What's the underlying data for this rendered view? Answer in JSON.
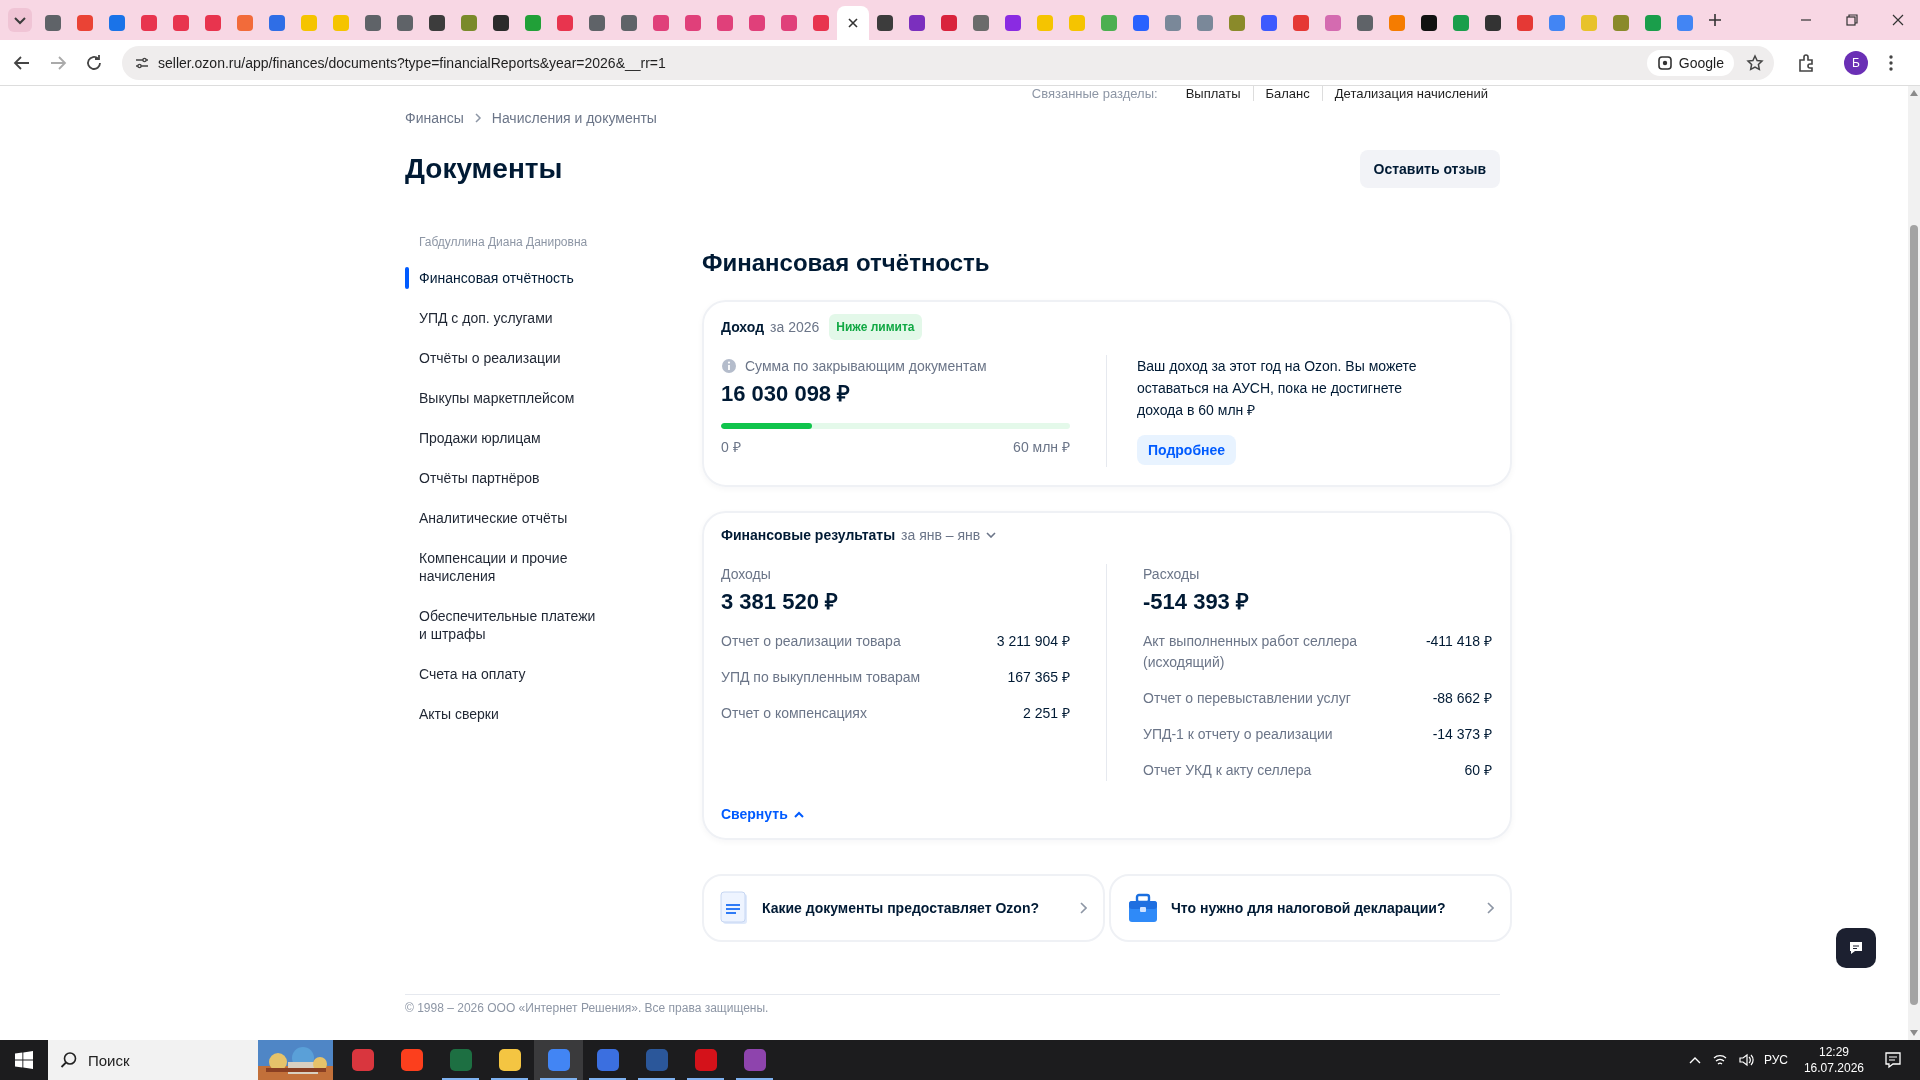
{
  "browser": {
    "tabs": [
      {
        "color": "#5f6368",
        "selected": false
      },
      {
        "color": "#ea4335",
        "selected": false
      },
      {
        "color": "#1a73e8",
        "selected": false
      },
      {
        "color": "#e8344e",
        "selected": false
      },
      {
        "color": "#e8344e",
        "selected": false
      },
      {
        "color": "#e8344e",
        "selected": false
      },
      {
        "color": "#f26b3a",
        "selected": false
      },
      {
        "color": "#2f6ee6",
        "selected": false
      },
      {
        "color": "#f5c400",
        "selected": false
      },
      {
        "color": "#f5c400",
        "selected": false
      },
      {
        "color": "#5f6368",
        "selected": false
      },
      {
        "color": "#5f6368",
        "selected": false
      },
      {
        "color": "#3c3c3c",
        "selected": false
      },
      {
        "color": "#7a8a2a",
        "selected": false
      },
      {
        "color": "#2b2b2b",
        "selected": false
      },
      {
        "color": "#21a038",
        "selected": false
      },
      {
        "color": "#e8344e",
        "selected": false
      },
      {
        "color": "#5f6368",
        "selected": false
      },
      {
        "color": "#5f6368",
        "selected": false
      },
      {
        "color": "#e0407a",
        "selected": false
      },
      {
        "color": "#e0407a",
        "selected": false
      },
      {
        "color": "#e0407a",
        "selected": false
      },
      {
        "color": "#e0407a",
        "selected": false
      },
      {
        "color": "#e0407a",
        "selected": false
      },
      {
        "color": "#e8344e",
        "selected": false
      },
      {
        "selected": true
      },
      {
        "color": "#3c3c3c",
        "selected": false
      },
      {
        "color": "#7b2fbe",
        "selected": false
      },
      {
        "color": "#d9233c",
        "selected": false
      },
      {
        "color": "#6b6b6b",
        "selected": false
      },
      {
        "color": "#8a2be2",
        "selected": false
      },
      {
        "color": "#f5c400",
        "selected": false
      },
      {
        "color": "#f5c400",
        "selected": false
      },
      {
        "color": "#4caf50",
        "selected": false
      },
      {
        "color": "#2962ff",
        "selected": false
      },
      {
        "color": "#7a8899",
        "selected": false
      },
      {
        "color": "#7a8899",
        "selected": false
      },
      {
        "color": "#8a8a2a",
        "selected": false
      },
      {
        "color": "#3d5afe",
        "selected": false
      },
      {
        "color": "#e53935",
        "selected": false
      },
      {
        "color": "#d46bb0",
        "selected": false
      },
      {
        "color": "#5f6368",
        "selected": false
      },
      {
        "color": "#f57c00",
        "selected": false
      },
      {
        "color": "#111111",
        "selected": false
      },
      {
        "color": "#1a9e4b",
        "selected": false
      },
      {
        "color": "#333333",
        "selected": false
      },
      {
        "color": "#e53935",
        "selected": false
      },
      {
        "color": "#4285f4",
        "selected": false
      },
      {
        "color": "#e8c22a",
        "selected": false
      },
      {
        "color": "#8a8a2a",
        "selected": false
      },
      {
        "color": "#1a9e4b",
        "selected": false
      },
      {
        "color": "#4285f4",
        "selected": false
      }
    ],
    "url": "seller.ozon.ru/app/finances/documents?type=financialReports&year=2026&__rr=1",
    "search_chip": "Google",
    "profile": "Б"
  },
  "related": {
    "label": "Связанные разделы:",
    "links": [
      "Выплаты",
      "Баланс",
      "Детализация начислений"
    ]
  },
  "breadcrumbs": [
    "Финансы",
    "Начисления и документы"
  ],
  "page_title": "Документы",
  "feedback_button": "Оставить отзыв",
  "sidebar": {
    "owner": "Габдуллина Диана Данировна",
    "items": [
      {
        "label": "Финансовая отчётность",
        "selected": true
      },
      {
        "label": "УПД с доп. услугами",
        "selected": false
      },
      {
        "label": "Отчёты о реализации",
        "selected": false
      },
      {
        "label": "Выкупы маркетплейсом",
        "selected": false
      },
      {
        "label": "Продажи юрлицам",
        "selected": false
      },
      {
        "label": "Отчёты партнёров",
        "selected": false
      },
      {
        "label": "Аналитические отчёты",
        "selected": false
      },
      {
        "label": "Компенсации и прочие начисления",
        "selected": false
      },
      {
        "label": "Обеспечительные платежи и штрафы",
        "selected": false
      },
      {
        "label": "Счета на оплату",
        "selected": false
      },
      {
        "label": "Акты сверки",
        "selected": false
      }
    ]
  },
  "section_title": "Финансовая отчётность",
  "income_card": {
    "title": "Доход",
    "period": "за 2026",
    "badge": "Ниже лимита",
    "caption": "Сумма по закрывающим документам",
    "amount": "16 030 098 ₽",
    "level": 0.26,
    "min_label": "0 ₽",
    "max_label": "60 млн ₽",
    "note": "Ваш доход за этот год на Ozon. Вы можете оставаться на АУСН, пока не достигнете дохода в 60 млн ₽",
    "button": "Подробнее"
  },
  "results_card": {
    "title": "Финансовые результаты",
    "period": "за янв – янв",
    "columns": [
      {
        "label": "Доходы",
        "total": "3 381 520 ₽",
        "rows": [
          {
            "name": "Отчет о реализации товара",
            "amount": "3 211 904 ₽"
          },
          {
            "name": "УПД по выкупленным товарам",
            "amount": "167 365 ₽"
          },
          {
            "name": "Отчет о компенсациях",
            "amount": "2 251 ₽"
          }
        ]
      },
      {
        "label": "Расходы",
        "total": "-514 393 ₽",
        "rows": [
          {
            "name": "Акт выполненных работ селлера (исходящий)",
            "amount": "-411 418 ₽"
          },
          {
            "name": "Отчет о перевыставлении услуг",
            "amount": "-88 662 ₽"
          },
          {
            "name": "УПД-1 к отчету о реализации",
            "amount": "-14 373 ₽"
          },
          {
            "name": "Отчет УКД к акту селлера",
            "amount": "60 ₽"
          }
        ]
      }
    ],
    "collapse": "Свернуть"
  },
  "help_links": [
    {
      "kind": "document",
      "text": "Какие документы предоставляет Ozon?"
    },
    {
      "kind": "briefcase",
      "text": "Что нужно для налоговой декларации?"
    }
  ],
  "footer": "© 1998 – 2026 ООО «Интернет Решения». Все права защищены.",
  "taskbar": {
    "search_placeholder": "Поиск",
    "apps": [
      {
        "color": "#d9363e",
        "selected": false,
        "running": false
      },
      {
        "color": "#fc3f1d",
        "selected": false,
        "running": false
      },
      {
        "color": "#1d6f42",
        "selected": false,
        "running": true
      },
      {
        "color": "#f4c542",
        "selected": false,
        "running": true
      },
      {
        "color": "#4285f4",
        "selected": true,
        "running": true
      },
      {
        "color": "#3b6fe0",
        "selected": false,
        "running": true
      },
      {
        "color": "#2b579a",
        "selected": false,
        "running": true
      },
      {
        "color": "#d4121a",
        "selected": false,
        "running": true
      },
      {
        "color": "#8e44ad",
        "selected": false,
        "running": true
      }
    ],
    "language": "РУС",
    "time": "12:29",
    "date": "16.07.2026"
  }
}
